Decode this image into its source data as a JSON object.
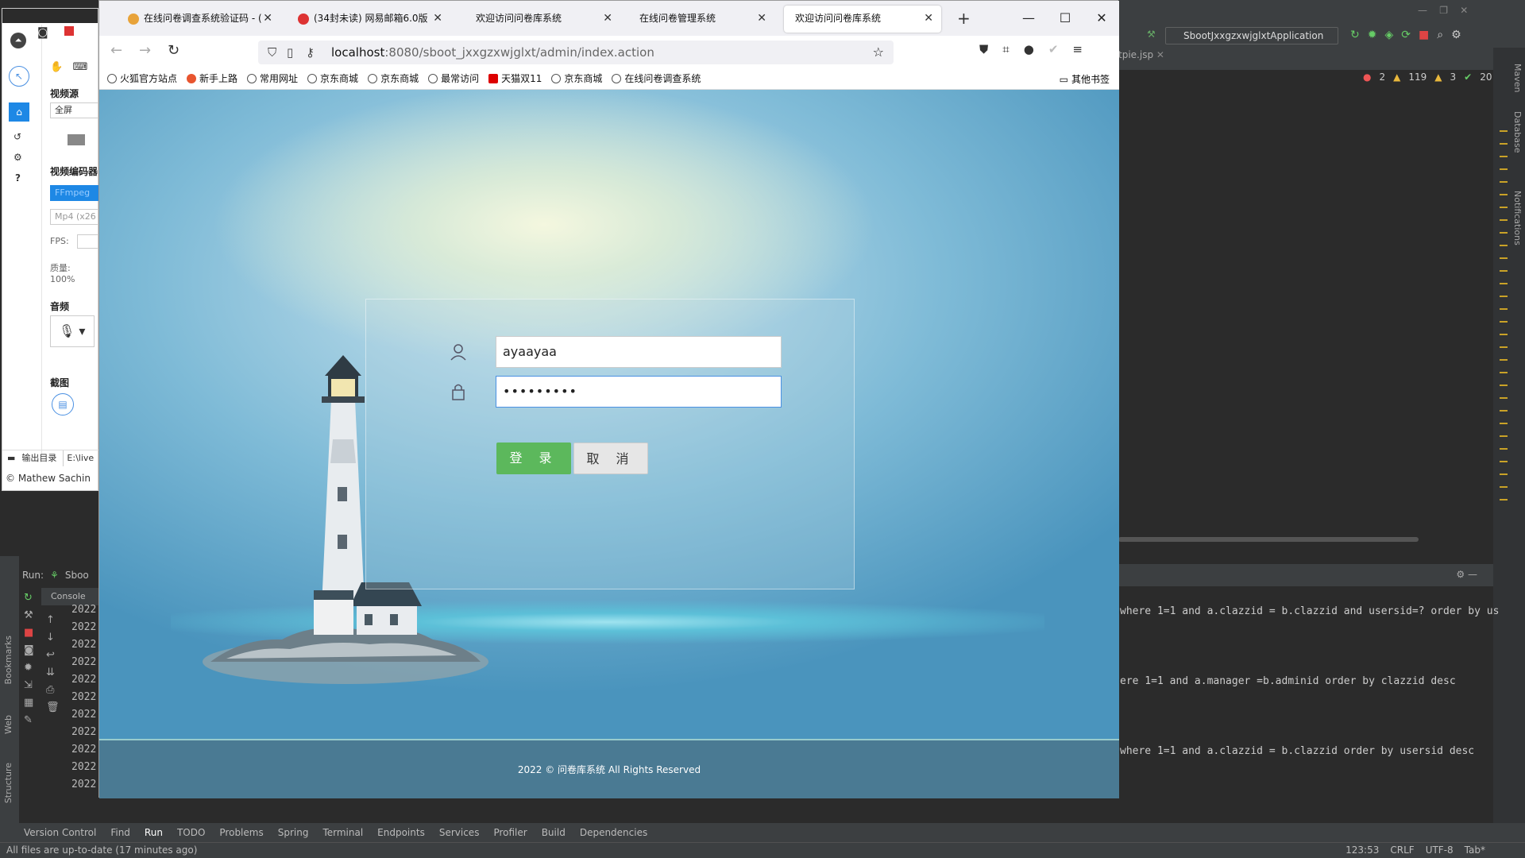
{
  "ide": {
    "run_config": "SbootJxxgzxwjglxtApplication",
    "editor_tab": "tpie.jsp",
    "inspections": {
      "errors": "2",
      "warnings": "119",
      "weak": "3",
      "ok": "20"
    },
    "sql_lines": [
      "where 1=1 and a.clazzid = b.clazzid and usersid=? order by us",
      "ere 1=1 and a.manager =b.adminid order by clazzid desc",
      "where 1=1 and a.clazzid = b.clazzid order by usersid desc"
    ],
    "run_label": "Run:",
    "run_tab": "Sboo",
    "console_tab": "Console",
    "log_years": [
      "2022",
      "2022",
      "2022",
      "2022",
      "2022",
      "2022",
      "2022",
      "2022",
      "2022",
      "2022",
      "2022"
    ],
    "bottom_tools": [
      "Version Control",
      "Find",
      "Run",
      "TODO",
      "Problems",
      "Spring",
      "Terminal",
      "Endpoints",
      "Services",
      "Profiler",
      "Build",
      "Dependencies"
    ],
    "status_left": "All files are up-to-date (17 minutes ago)",
    "status_right": [
      "123:53",
      "CRLF",
      "UTF-8",
      "Tab*"
    ],
    "side_labels": {
      "bookmarks": "Bookmarks",
      "web": "Web",
      "structure": "Structure",
      "maven": "Maven",
      "database": "Database",
      "notifications": "Notifications"
    }
  },
  "recorder": {
    "video_source_label": "视频源",
    "video_source_value": "全屏",
    "encoder_label": "视频编码器",
    "encoder_value": "FFmpeg",
    "format_value": "Mp4 (x26",
    "fps_label": "FPS:",
    "quality_label": "质量: 100%",
    "audio_label": "音频",
    "screenshot_label": "截图",
    "output_label": "输出目录",
    "output_path": "E:\\live",
    "copyright": "© Mathew Sachin"
  },
  "browser": {
    "tabs": [
      {
        "label": "在线问卷调查系统验证码 - (",
        "fav": "#e8a33a"
      },
      {
        "label": "(34封未读) 网易邮箱6.0版",
        "fav": "#d33"
      },
      {
        "label": "欢迎访问问卷库系统",
        "fav": ""
      },
      {
        "label": "在线问卷管理系统",
        "fav": ""
      },
      {
        "label": "欢迎访问问卷库系统",
        "fav": ""
      }
    ],
    "url_host": "localhost",
    "url_rest": ":8080/sboot_jxxgzxwjglxt/admin/index.action",
    "bookmarks": [
      "火狐官方站点",
      "新手上路",
      "常用网址",
      "京东商城",
      "京东商城",
      "最常访问",
      "天猫双11",
      "京东商城",
      "在线问卷调查系统"
    ],
    "other_bookmarks": "其他书签"
  },
  "login": {
    "username": "ayaayaa",
    "password_mask": "•••••••••",
    "login_button": "登 录",
    "cancel_button": "取 消"
  },
  "footer": {
    "text": "2022 © 问卷库系统 All Rights Reserved"
  }
}
